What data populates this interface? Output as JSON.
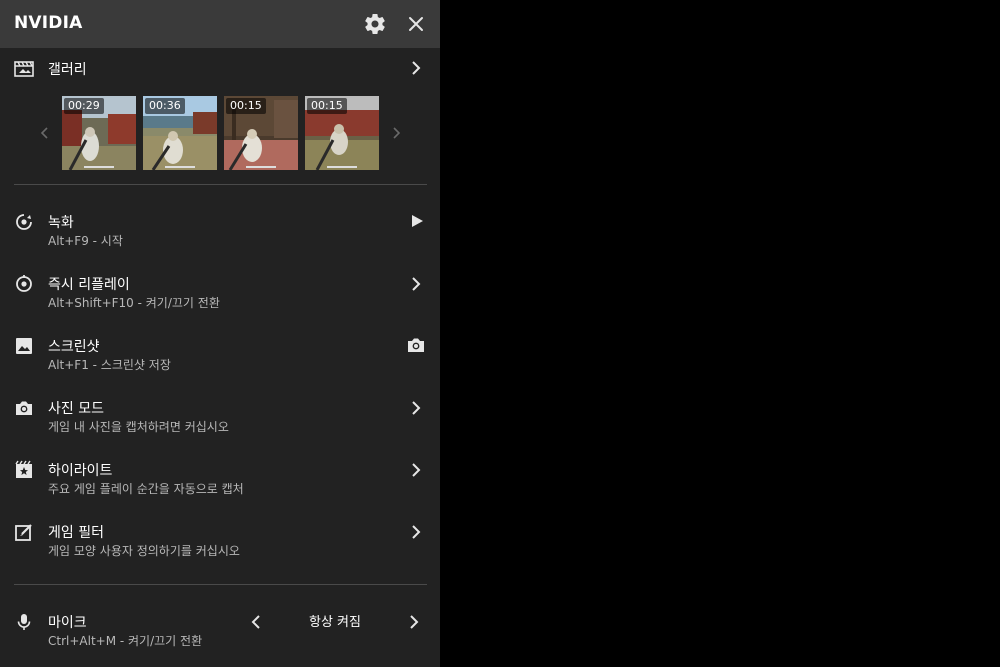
{
  "header": {
    "brand": "NVIDIA",
    "icons": {
      "settings": "gear-icon",
      "close": "close-icon"
    }
  },
  "gallery": {
    "title": "갤러리",
    "icon": "gallery-film-icon",
    "thumbnails": [
      {
        "duration": "00:29"
      },
      {
        "duration": "00:36"
      },
      {
        "duration": "00:15"
      },
      {
        "duration": "00:15"
      }
    ]
  },
  "menu": {
    "record": {
      "title": "녹화",
      "subtitle": "Alt+F9 - 시작",
      "icon": "record-icon",
      "action_icon": "play-icon"
    },
    "instant_replay": {
      "title": "즉시 리플레이",
      "subtitle": "Alt+Shift+F10 - 켜기/끄기 전환",
      "icon": "instant-replay-icon"
    },
    "screenshot": {
      "title": "스크린샷",
      "subtitle": "Alt+F1 - 스크린샷 저장",
      "icon": "image-icon",
      "action_icon": "camera-icon"
    },
    "photo_mode": {
      "title": "사진 모드",
      "subtitle": "게임 내 사진을 캡처하려면 커십시오",
      "icon": "camera-icon"
    },
    "highlights": {
      "title": "하이라이트",
      "subtitle": "주요 게임 플레이 순간을 자동으로 캡처",
      "icon": "highlights-icon"
    },
    "game_filter": {
      "title": "게임 필터",
      "subtitle": "게임 모양 사용자 정의하기를 커십시오",
      "icon": "filter-icon"
    }
  },
  "mic": {
    "title": "마이크",
    "subtitle": "Ctrl+Alt+M - 켜기/끄기 전환",
    "value": "항상 켜짐",
    "icon": "microphone-icon"
  },
  "colors": {
    "panel_bg": "#222222",
    "header_bg": "#3a3a3a",
    "divider": "#4a4a4a",
    "subtitle": "#b8b8b8"
  }
}
